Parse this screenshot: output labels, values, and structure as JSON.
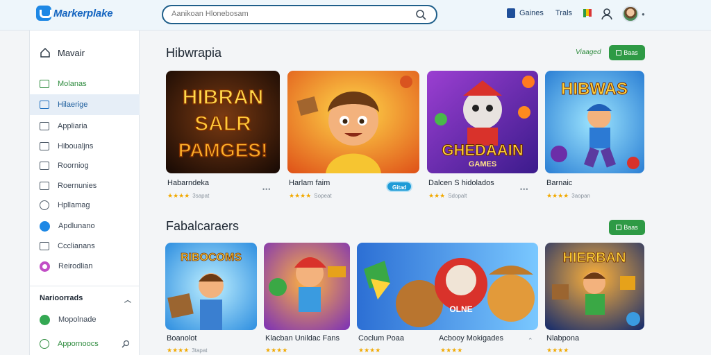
{
  "header": {
    "logo_text": "Markerplake",
    "search_placeholder": "Aanikoan Hlonebosam",
    "games_label": "Gaines",
    "trials_label": "Trals"
  },
  "sidebar": {
    "home_label": "Mavair",
    "items": [
      {
        "label": "Molanas",
        "icon": "store-icon"
      },
      {
        "label": "Hilaerige",
        "icon": "card-icon"
      },
      {
        "label": "Appliaria",
        "icon": "grid-icon"
      },
      {
        "label": "Hiboualjns",
        "icon": "mail-icon"
      },
      {
        "label": "Roorniog",
        "icon": "edit-icon"
      },
      {
        "label": "Roernunies",
        "icon": "box-icon"
      },
      {
        "label": "Hpllamag",
        "icon": "cloud-icon"
      },
      {
        "label": "Apdlunano",
        "icon": "arrow-icon"
      },
      {
        "label": "Ccclianans",
        "icon": "square-icon"
      },
      {
        "label": "Reirodlian",
        "icon": "circle-icon"
      }
    ],
    "section_title": "Narioorrads",
    "section_items": [
      {
        "label": "Mopolnade",
        "icon": "globe-icon"
      },
      {
        "label": "Appornoocs",
        "icon": "chat-icon"
      }
    ]
  },
  "sections": [
    {
      "title": "Hibwrapia",
      "view_label": "Viaaged",
      "button_label": "Baas",
      "cards": [
        {
          "title": "Habarndeka",
          "meta": "3sapat",
          "art_text": [
            "HIBRAN",
            "SALR",
            "PAMGES!"
          ]
        },
        {
          "title": "Harlam faim",
          "meta": "Sopeat",
          "badge": "Gitad"
        },
        {
          "title": "Dalcen S hidolados",
          "meta": "Sdopalt",
          "art_text": [
            "GHEDAAIN",
            "GAMES"
          ]
        },
        {
          "title": "Barnaic",
          "meta": "3aopan",
          "art_text": [
            "HIBWAS"
          ]
        }
      ]
    },
    {
      "title": "Fabalcaraers",
      "button_label": "Baas",
      "cards": [
        {
          "title": "Boanolot",
          "meta": "3tapat",
          "art_text": [
            "RIBOCOMS"
          ]
        },
        {
          "title": "Klacban Unildac Fans",
          "meta": ""
        },
        {
          "title": "Coclum Poaa",
          "second_title": "Acbooy Mokigades",
          "meta": "",
          "art_text": [
            "OLNE"
          ]
        },
        {
          "title": "Nlabpona",
          "meta": "",
          "art_text": [
            "HIERBAN"
          ]
        }
      ]
    }
  ],
  "colors": {
    "accent_green": "#2e9a45",
    "accent_blue": "#1e88e5",
    "star": "#f2a900"
  }
}
